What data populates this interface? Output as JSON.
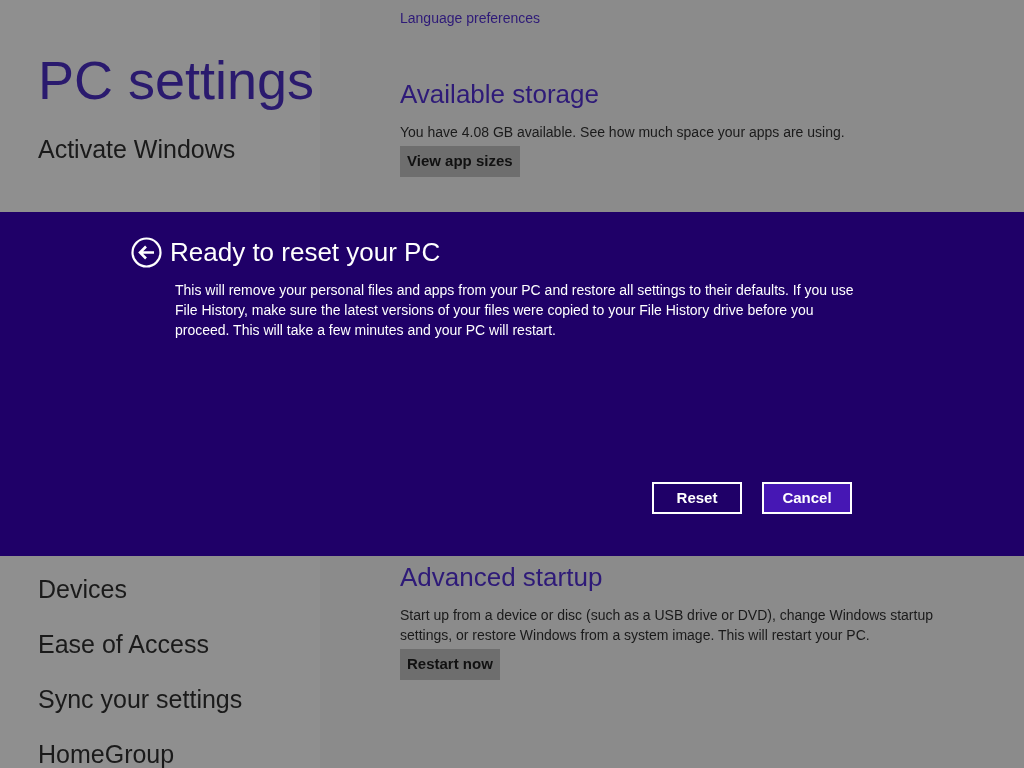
{
  "sidebar": {
    "title": "PC settings",
    "items_top": [
      {
        "label": "Activate Windows"
      }
    ],
    "items_bottom": [
      {
        "label": "Devices"
      },
      {
        "label": "Ease of Access"
      },
      {
        "label": "Sync your settings"
      },
      {
        "label": "HomeGroup"
      }
    ]
  },
  "content": {
    "link": "Language preferences",
    "sections_top": [
      {
        "heading": "Available storage",
        "text": "You have 4.08 GB available. See how much space your apps are using.",
        "button": "View app sizes"
      }
    ],
    "sections_bottom": [
      {
        "heading": "Advanced startup",
        "text": "Start up from a device or disc (such as a USB drive or DVD), change Windows startup settings, or restore Windows from a system image. This will restart your PC.",
        "button": "Restart now"
      }
    ]
  },
  "dialog": {
    "title": "Ready to reset your PC",
    "text": "This will remove your personal files and apps from your PC and restore all settings to their defaults. If you use File History, make sure the latest versions of your files were copied to your File History drive before you proceed. This will take a few minutes and your PC will restart.",
    "buttons": [
      {
        "label": "Reset",
        "kind": "outline"
      },
      {
        "label": "Cancel",
        "kind": "filled"
      }
    ]
  }
}
